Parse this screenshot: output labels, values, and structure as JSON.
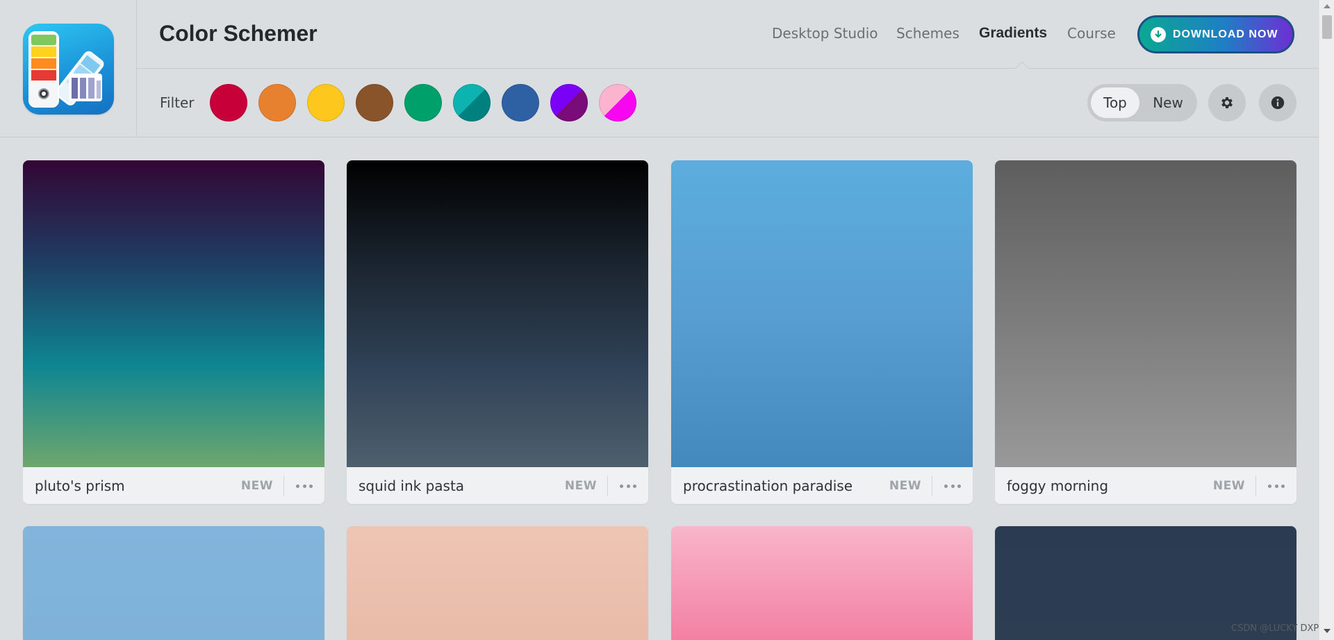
{
  "header": {
    "app_title": "Color Schemer",
    "nav": [
      {
        "label": "Desktop Studio",
        "active": false
      },
      {
        "label": "Schemes",
        "active": false
      },
      {
        "label": "Gradients",
        "active": true
      },
      {
        "label": "Course",
        "active": false
      }
    ],
    "download_label": "DOWNLOAD NOW",
    "download_icon": "download-circle-icon"
  },
  "filter": {
    "label": "Filter",
    "swatches": [
      {
        "name": "red",
        "colors": [
          "#c8003a"
        ]
      },
      {
        "name": "orange",
        "colors": [
          "#e8812f"
        ]
      },
      {
        "name": "yellow",
        "colors": [
          "#fdc71e"
        ]
      },
      {
        "name": "brown",
        "colors": [
          "#8a542a"
        ]
      },
      {
        "name": "green",
        "colors": [
          "#00a06a"
        ]
      },
      {
        "name": "teal",
        "colors": [
          "#0cb3b0",
          "#00807f"
        ]
      },
      {
        "name": "blue",
        "colors": [
          "#2e61a3"
        ]
      },
      {
        "name": "purple",
        "colors": [
          "#7a00f6",
          "#7a0c7a"
        ]
      },
      {
        "name": "pink",
        "colors": [
          "#fcb3cd",
          "#f706f0"
        ]
      }
    ],
    "sort": {
      "options": [
        "Top",
        "New"
      ],
      "selected": "Top"
    },
    "settings_icon": "gear-icon",
    "info_icon": "info-icon"
  },
  "gradients": [
    {
      "name": "pluto's prism",
      "badge": "NEW",
      "stops": [
        "#330634",
        "#1f3d63",
        "#0e8592",
        "#6ea66d"
      ]
    },
    {
      "name": "squid ink pasta",
      "badge": "NEW",
      "stops": [
        "#000000",
        "#1a242e",
        "#2f4156",
        "#4e5f6d"
      ]
    },
    {
      "name": "procrastination paradise",
      "badge": "NEW",
      "stops": [
        "#5caddf",
        "#589ed1",
        "#4389bd"
      ]
    },
    {
      "name": "foggy morning",
      "badge": "NEW",
      "stops": [
        "#5e5e5e",
        "#7b7b7b",
        "#999999"
      ]
    },
    {
      "name": "",
      "badge": "",
      "stops": [
        "#82b5db",
        "#7fb2d8"
      ]
    },
    {
      "name": "",
      "badge": "",
      "stops": [
        "#eec5b3",
        "#e8bba8"
      ]
    },
    {
      "name": "",
      "badge": "",
      "stops": [
        "#f8b6ca",
        "#f37ea2"
      ]
    },
    {
      "name": "",
      "badge": "",
      "stops": [
        "#2b3c52",
        "#2d3d52"
      ]
    }
  ],
  "watermark": "CSDN @LUCKY DXP"
}
